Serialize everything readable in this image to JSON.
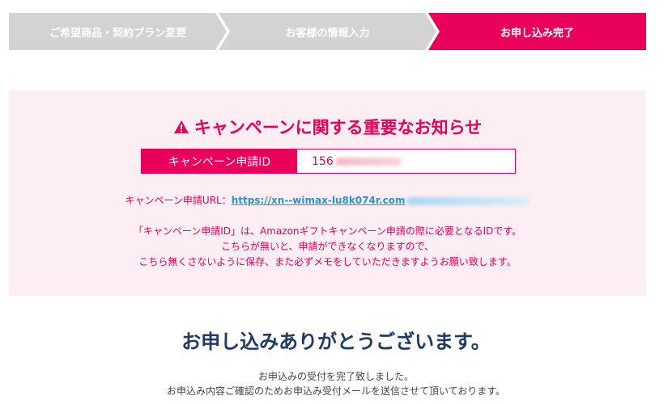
{
  "steps": [
    {
      "label": "ご希望商品・契約プラン変更",
      "active": false
    },
    {
      "label": "お客様の情報入力",
      "active": false
    },
    {
      "label": "お申し込み完了",
      "active": true
    }
  ],
  "colors": {
    "accent": "#e8005a",
    "step_inactive": "#d3d3d3",
    "notice_bg": "#fdeef3",
    "link": "#1e98d8",
    "heading": "#1f3a66"
  },
  "notice": {
    "icon": "warning-icon",
    "title": "キャンペーンに関する重要なお知らせ",
    "id_label": "キャンペーン申請ID",
    "id_value_visible": "156",
    "url_label": "キャンペーン申請URL：",
    "url_text": "https://xn--wimax-lu8k074r.com",
    "message_lines": [
      "「キャンペーン申請ID」は、Amazonギフトキャンペーン申請の際に必要となるIDです。",
      "こちらが無いと、申請ができなくなりますので、",
      "こちら無くさないように保存、また必ずメモをしていただきますようお願い致します。"
    ]
  },
  "thanks": {
    "title": "お申し込みありがとうございます。",
    "lines": [
      "お申込みの受付を完了致しました。",
      "お申込み内容ご確認のためお申込み受付メールを送信させて頂いております。"
    ]
  }
}
